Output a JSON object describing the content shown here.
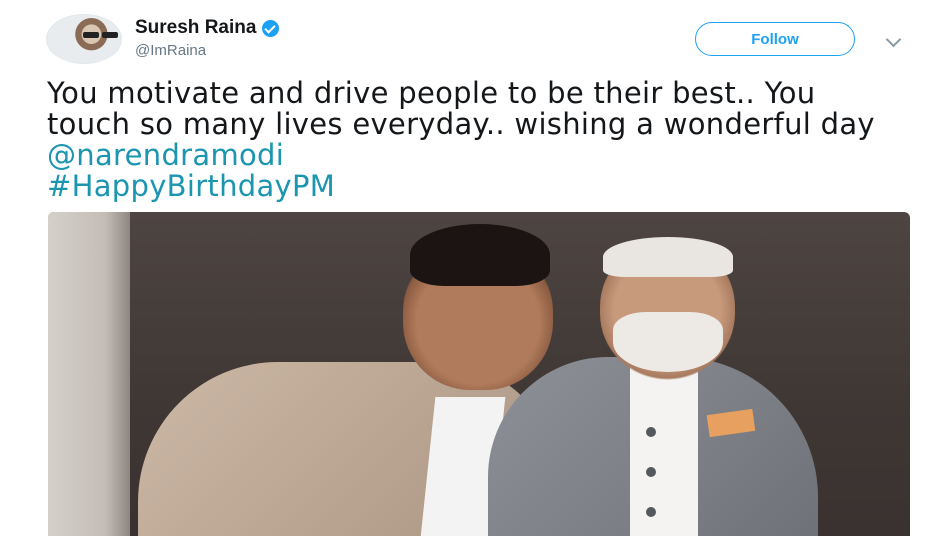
{
  "user": {
    "name": "Suresh Raina",
    "handle": "@ImRaina",
    "verified": true
  },
  "actions": {
    "follow_label": "Follow",
    "menu_icon": "chevron-down-icon"
  },
  "tweet": {
    "text_plain": "You motivate and drive people to be their best.. You touch so many lives everyday.. wishing a wonderful day ",
    "mention": "@narendramodi",
    "hashtag": "#HappyBirthdayPM"
  },
  "colors": {
    "link": "#1b95b0",
    "accent": "#1da1f2",
    "text": "#14171a",
    "secondary": "#657786"
  }
}
